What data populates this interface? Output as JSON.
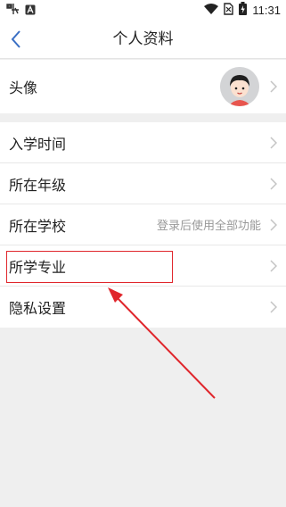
{
  "status_bar": {
    "time": "11:31",
    "left_icons": [
      "app-notification-icon",
      "a-notification-icon"
    ],
    "right_icons": [
      "wifi-icon",
      "no-sim-icon",
      "battery-charging-icon"
    ]
  },
  "header": {
    "title": "个人资料",
    "back_icon": "chevron-left-icon"
  },
  "avatar_section": {
    "label": "头像"
  },
  "rows": [
    {
      "label": "入学时间",
      "value": ""
    },
    {
      "label": "所在年级",
      "value": ""
    },
    {
      "label": "所在学校",
      "value": "登录后使用全部功能"
    },
    {
      "label": "所学专业",
      "value": ""
    },
    {
      "label": "隐私设置",
      "value": ""
    }
  ],
  "annotation": {
    "color": "#e0262c",
    "target": "所学专业"
  }
}
